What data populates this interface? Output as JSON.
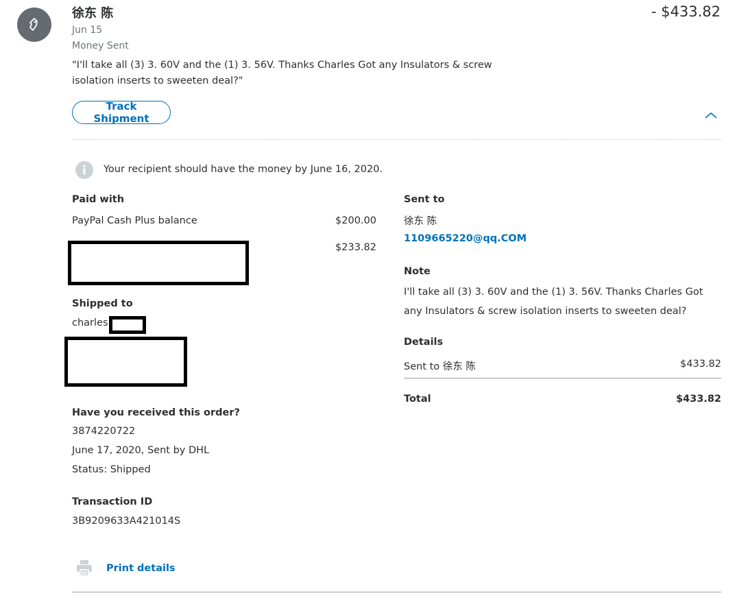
{
  "header": {
    "recipient_name": "徐东 陈",
    "date": "Jun 15",
    "type": "Money Sent",
    "quote": "\"I'll take all (3) 3. 60V and the (1) 3. 56V. Thanks Charles Got any Insulators & screw isolation inserts to sweeten deal?\"",
    "amount": "- $433.82"
  },
  "actions": {
    "track_label": "Track Shipment"
  },
  "notice": {
    "text": "Your recipient should have the money by June 16, 2020."
  },
  "paid_with": {
    "label": "Paid with",
    "items": [
      {
        "source": "PayPal Cash Plus balance",
        "amount": "$200.00"
      },
      {
        "source": "",
        "amount": "$233.82"
      }
    ]
  },
  "shipped_to": {
    "label": "Shipped to",
    "name": "charles"
  },
  "order": {
    "label": "Have you received this order?",
    "tracking_number": "3874220722",
    "shipped_line": "June 17, 2020, Sent by DHL",
    "status": "Status: Shipped"
  },
  "transaction": {
    "label": "Transaction ID",
    "id": "3B9209633A421014S"
  },
  "print": {
    "label": "Print details"
  },
  "sent_to": {
    "label": "Sent to",
    "name": "徐东 陈",
    "email": "1109665220@qq.COM"
  },
  "note": {
    "label": "Note",
    "text": "I'll take all (3) 3. 60V and the (1) 3. 56V. Thanks Charles Got any Insulators & screw isolation inserts to sweeten deal?"
  },
  "details": {
    "label": "Details",
    "line_label": "Sent to 徐东 陈",
    "line_amount": "$433.82",
    "total_label": "Total",
    "total_amount": "$433.82"
  },
  "colors": {
    "accent": "#0070ba",
    "text": "#2c2e2f",
    "muted": "#6c7378",
    "avatar": "#656b70"
  },
  "icons": {
    "avatar": "tag-icon",
    "expand": "chevron-up-icon",
    "notice": "info-icon",
    "print": "printer-icon"
  }
}
